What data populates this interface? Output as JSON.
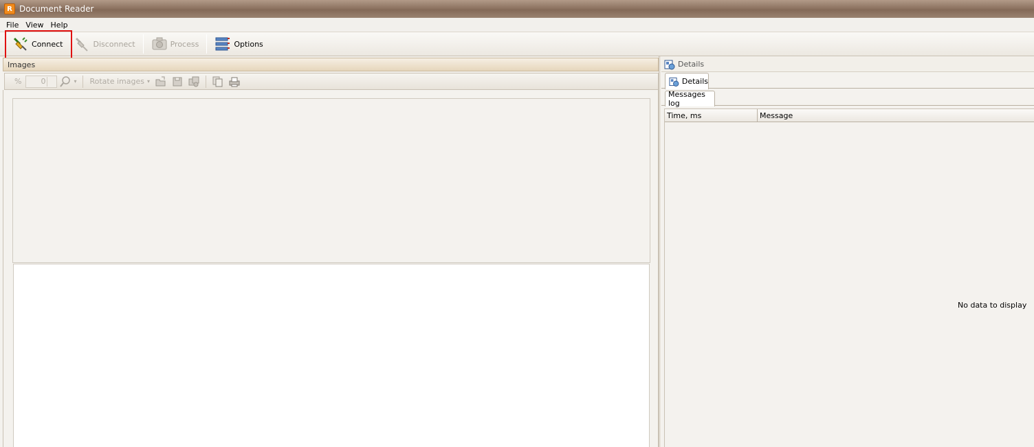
{
  "window": {
    "title": "Document Reader",
    "app_icon": "reader-app-icon"
  },
  "menu": {
    "items": [
      "File",
      "View",
      "Help"
    ]
  },
  "toolbar": {
    "connect": "Connect",
    "disconnect": "Disconnect",
    "process": "Process",
    "options": "Options"
  },
  "images": {
    "header": "Images",
    "toolbar": {
      "percent": "%",
      "zoom_value": "0",
      "rotate": "Rotate images"
    }
  },
  "details": {
    "header": "Details",
    "tab": "Details",
    "subtab": "Messages log",
    "columns": [
      "Time, ms",
      "Message"
    ],
    "empty_text": "No data to display"
  },
  "colors": {
    "highlight": "#e01010",
    "title_bar": "#8e7462",
    "header_tan": "#e6d6bc"
  }
}
